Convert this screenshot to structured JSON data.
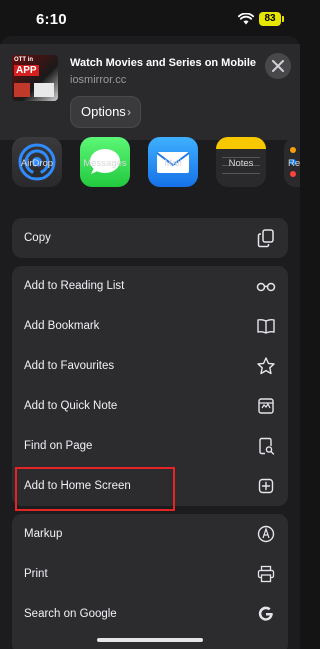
{
  "status": {
    "time": "6:10",
    "battery": "83"
  },
  "share_header": {
    "thumbnail_text_1": "OTT in",
    "thumbnail_text_2": "APP",
    "page_title": "Watch Movies and Series on Mobile",
    "domain": "iosmirror.cc",
    "options_label": "Options"
  },
  "apps": [
    {
      "label": "AirDrop",
      "icon": "airdrop-icon"
    },
    {
      "label": "Messages",
      "icon": "messages-icon"
    },
    {
      "label": "Mail",
      "icon": "mail-icon"
    },
    {
      "label": "Notes",
      "icon": "notes-icon"
    },
    {
      "label": "Re",
      "icon": "reminders-icon"
    }
  ],
  "actions": {
    "group1": [
      {
        "label": "Copy",
        "icon": "copy-icon"
      }
    ],
    "group2": [
      {
        "label": "Add to Reading List",
        "icon": "glasses-icon"
      },
      {
        "label": "Add Bookmark",
        "icon": "book-icon"
      },
      {
        "label": "Add to Favourites",
        "icon": "star-icon"
      },
      {
        "label": "Add to Quick Note",
        "icon": "quick-note-icon"
      },
      {
        "label": "Find on Page",
        "icon": "find-icon"
      },
      {
        "label": "Add to Home Screen",
        "icon": "plus-square-icon"
      }
    ],
    "group3": [
      {
        "label": "Markup",
        "icon": "markup-icon"
      },
      {
        "label": "Print",
        "icon": "printer-icon"
      },
      {
        "label": "Search on Google",
        "icon": "google-icon"
      }
    ]
  },
  "colors": {
    "highlight": "#e32525",
    "sheet": "#1c1c1e",
    "row_bg": "#2c2c2e"
  }
}
